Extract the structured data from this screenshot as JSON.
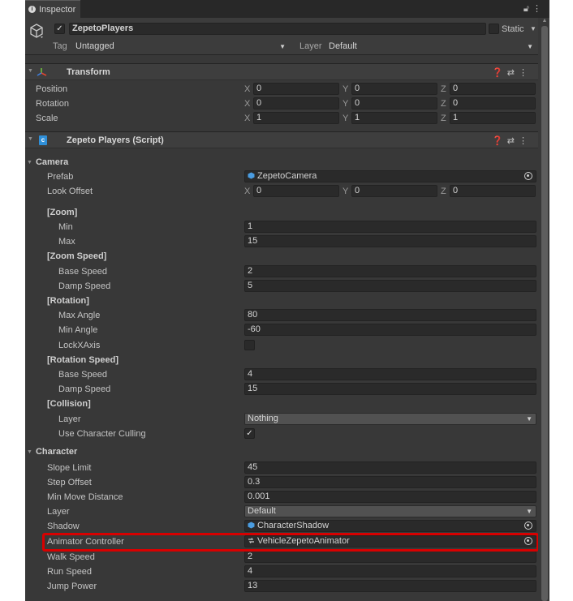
{
  "tab": {
    "label": "Inspector"
  },
  "header": {
    "object_name": "ZepetoPlayers",
    "static_label": "Static",
    "tag_label": "Tag",
    "tag_value": "Untagged",
    "layer_label": "Layer",
    "layer_value": "Default"
  },
  "axis": {
    "x": "X",
    "y": "Y",
    "z": "Z"
  },
  "transform": {
    "title": "Transform",
    "position": {
      "label": "Position",
      "x": "0",
      "y": "0",
      "z": "0"
    },
    "rotation": {
      "label": "Rotation",
      "x": "0",
      "y": "0",
      "z": "0"
    },
    "scale": {
      "label": "Scale",
      "x": "1",
      "y": "1",
      "z": "1"
    }
  },
  "script": {
    "title": "Zepeto Players (Script)",
    "camera": {
      "section": "Camera",
      "prefab_label": "Prefab",
      "prefab_value": "ZepetoCamera",
      "look_offset_label": "Look Offset",
      "look_offset": {
        "x": "0",
        "y": "0",
        "z": "0"
      },
      "zoom_header": "[Zoom]",
      "zoom_min_label": "Min",
      "zoom_min": "1",
      "zoom_max_label": "Max",
      "zoom_max": "15",
      "zoom_speed_header": "[Zoom Speed]",
      "zoom_base_speed_label": "Base Speed",
      "zoom_base_speed": "2",
      "zoom_damp_speed_label": "Damp Speed",
      "zoom_damp_speed": "5",
      "rotation_header": "[Rotation]",
      "max_angle_label": "Max Angle",
      "max_angle": "80",
      "min_angle_label": "Min Angle",
      "min_angle": "-60",
      "lock_x_axis_label": "LockXAxis",
      "rotation_speed_header": "[Rotation Speed]",
      "rot_base_speed_label": "Base Speed",
      "rot_base_speed": "4",
      "rot_damp_speed_label": "Damp Speed",
      "rot_damp_speed": "15",
      "collision_header": "[Collision]",
      "collision_layer_label": "Layer",
      "collision_layer": "Nothing",
      "use_culling_label": "Use Character Culling"
    },
    "character": {
      "section": "Character",
      "slope_limit_label": "Slope Limit",
      "slope_limit": "45",
      "step_offset_label": "Step Offset",
      "step_offset": "0.3",
      "min_move_label": "Min Move Distance",
      "min_move": "0.001",
      "layer_label": "Layer",
      "layer": "Default",
      "shadow_label": "Shadow",
      "shadow": "CharacterShadow",
      "animator_label": "Animator Controller",
      "animator": "VehicleZepetoAnimator",
      "walk_speed_label": "Walk Speed",
      "walk_speed": "2",
      "run_speed_label": "Run Speed",
      "run_speed": "4",
      "jump_power_label": "Jump Power",
      "jump_power": "13"
    }
  },
  "colors": {
    "highlight": "#d80000",
    "panel": "#383838",
    "field": "#2a2a2a"
  }
}
